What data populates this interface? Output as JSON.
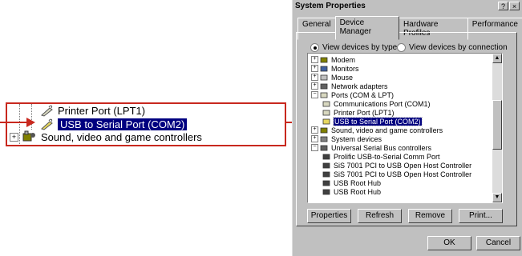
{
  "zoom": {
    "rows": [
      "Printer Port (LPT1)",
      "USB to Serial Port (COM2)",
      "Sound, video and game controllers"
    ],
    "expander": "+"
  },
  "dialog": {
    "title": "System Properties",
    "help_btn": "?",
    "close_btn": "×",
    "tabs": [
      "General",
      "Device Manager",
      "Hardware Profiles",
      "Performance"
    ],
    "radio_type": "View devices by type",
    "radio_connection": "View devices by connection",
    "tree": [
      {
        "label": "Modem",
        "exp": "+"
      },
      {
        "label": "Monitors",
        "exp": "+"
      },
      {
        "label": "Mouse",
        "exp": "+"
      },
      {
        "label": "Network adapters",
        "exp": "+"
      },
      {
        "label": "Ports (COM & LPT)",
        "exp": "−"
      },
      {
        "label": "Communications Port (COM1)"
      },
      {
        "label": "Printer Port (LPT1)"
      },
      {
        "label": "USB to Serial Port (COM2)"
      },
      {
        "label": "Sound, video and game controllers",
        "exp": "+"
      },
      {
        "label": "System devices",
        "exp": "+"
      },
      {
        "label": "Universal Serial Bus controllers",
        "exp": "−"
      },
      {
        "label": "Prolific USB-to-Serial Comm Port"
      },
      {
        "label": "SiS 7001 PCI to USB Open Host Controller"
      },
      {
        "label": "SiS 7001 PCI to USB Open Host Controller"
      },
      {
        "label": "USB Root Hub"
      },
      {
        "label": "USB Root Hub"
      }
    ],
    "buttons": {
      "properties": "Properties",
      "refresh": "Refresh",
      "remove": "Remove",
      "print": "Print...",
      "ok": "OK",
      "cancel": "Cancel"
    }
  },
  "colors": {
    "accent": "#c8281e",
    "selection": "#000080"
  }
}
